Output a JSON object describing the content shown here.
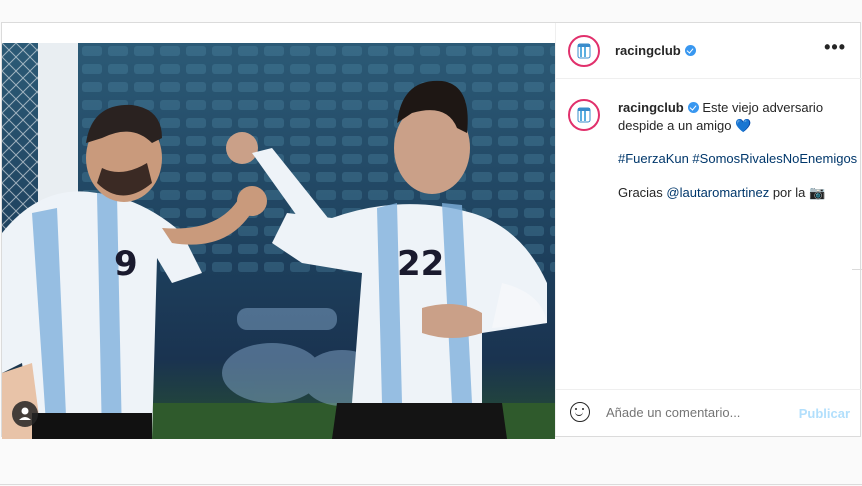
{
  "post": {
    "account": {
      "username": "racingclub",
      "verified": true,
      "avatar_icon": "racing-club-crest-icon"
    },
    "more_icon": "ellipsis-icon",
    "more_label": "•••",
    "photo": {
      "players": [
        {
          "number": "9"
        },
        {
          "number": "22"
        }
      ],
      "user_tag_icon": "user-tag-icon"
    },
    "caption": {
      "username": "racingclub",
      "text": "Este viejo adversario despide a un amigo",
      "emoji": "💙",
      "hashtags": "#FuerzaKun #SomosRivalesNoEnemigos",
      "thanks_prefix": "Gracias ",
      "mention": "@lautaromartinez",
      "thanks_suffix": " por la ",
      "camera_emoji": "📷"
    },
    "comment": {
      "emoji_icon": "smiley-icon",
      "placeholder": "Añade un comentario...",
      "publish_label": "Publicar"
    }
  },
  "colors": {
    "verified_blue": "#3897f0",
    "link": "#00376b",
    "publish_disabled": "#b2dffc",
    "avatar_ring": "#e1306c",
    "jersey_blue": "#75aadb"
  }
}
